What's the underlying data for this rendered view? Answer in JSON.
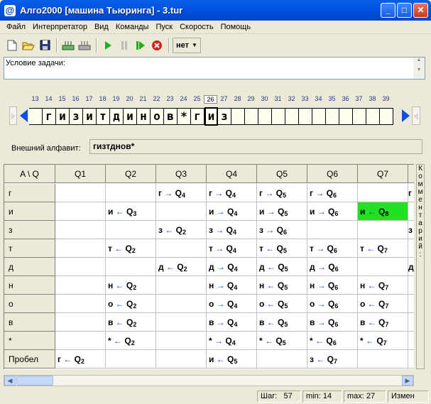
{
  "window": {
    "title": "Алго2000 [машина Тьюринга] - 3.tur",
    "app_icon": "@"
  },
  "menu": [
    "Файл",
    "Интерпретатор",
    "Вид",
    "Команды",
    "Пуск",
    "Скорость",
    "Помощь"
  ],
  "toolbar": {
    "speed_label": "нет"
  },
  "condition": {
    "label": "Условие задачи:"
  },
  "tape": {
    "numbers": [
      "13",
      "14",
      "15",
      "16",
      "17",
      "18",
      "19",
      "20",
      "21",
      "22",
      "23",
      "24",
      "25",
      "26",
      "27",
      "28",
      "29",
      "30",
      "31",
      "32",
      "33",
      "34",
      "35",
      "36",
      "37",
      "38",
      "39"
    ],
    "current_number": "26",
    "cells": [
      "",
      "г",
      "и",
      "з",
      "и",
      "т",
      "д",
      "и",
      "н",
      "о",
      "в",
      "*",
      "г",
      "и",
      "з",
      "",
      "",
      "",
      "",
      "",
      "",
      "",
      "",
      "",
      "",
      "",
      ""
    ],
    "current_index": 13
  },
  "alphabet": {
    "label": "Внешний алфавит:",
    "value": "гизтднов*"
  },
  "grid": {
    "corner": "A \\ Q",
    "columns": [
      "Q1",
      "Q2",
      "Q3",
      "Q4",
      "Q5",
      "Q6",
      "Q7"
    ],
    "partial_col_letters": [
      "г",
      "",
      "з",
      "",
      "д",
      "",
      "",
      "",
      "",
      ""
    ],
    "rows": [
      {
        "symbol": "г",
        "cells": [
          null,
          null,
          {
            "s": "г",
            "a": "→",
            "q": "Q",
            "n": "4"
          },
          {
            "s": "г",
            "a": "→",
            "q": "Q",
            "n": "4"
          },
          {
            "s": "г",
            "a": "→",
            "q": "Q",
            "n": "5"
          },
          {
            "s": "г",
            "a": "→",
            "q": "Q",
            "n": "6"
          },
          null
        ]
      },
      {
        "symbol": "и",
        "cells": [
          null,
          {
            "s": "и",
            "a": "←",
            "q": "Q",
            "n": "3"
          },
          null,
          {
            "s": "и",
            "a": "→",
            "q": "Q",
            "n": "4"
          },
          {
            "s": "и",
            "a": "→",
            "q": "Q",
            "n": "5"
          },
          {
            "s": "и",
            "a": "→",
            "q": "Q",
            "n": "6"
          },
          {
            "s": "и",
            "a": "←",
            "q": "Q",
            "n": "8",
            "hl": true
          }
        ]
      },
      {
        "symbol": "з",
        "cells": [
          null,
          null,
          {
            "s": "з",
            "a": "←",
            "q": "Q",
            "n": "2"
          },
          {
            "s": "з",
            "a": "→",
            "q": "Q",
            "n": "4"
          },
          {
            "s": "з",
            "a": "→",
            "q": "Q",
            "n": "6"
          },
          null,
          null
        ]
      },
      {
        "symbol": "т",
        "cells": [
          null,
          {
            "s": "т",
            "a": "←",
            "q": "Q",
            "n": "2"
          },
          null,
          {
            "s": "т",
            "a": "→",
            "q": "Q",
            "n": "4"
          },
          {
            "s": "т",
            "a": "←",
            "q": "Q",
            "n": "5"
          },
          {
            "s": "т",
            "a": "→",
            "q": "Q",
            "n": "6"
          },
          {
            "s": "т",
            "a": "←",
            "q": "Q",
            "n": "7"
          }
        ]
      },
      {
        "symbol": "д",
        "cells": [
          null,
          null,
          {
            "s": "д",
            "a": "←",
            "q": "Q",
            "n": "2"
          },
          {
            "s": "д",
            "a": "→",
            "q": "Q",
            "n": "4"
          },
          {
            "s": "д",
            "a": "←",
            "q": "Q",
            "n": "5"
          },
          {
            "s": "д",
            "a": "→",
            "q": "Q",
            "n": "6"
          },
          null
        ]
      },
      {
        "symbol": "н",
        "cells": [
          null,
          {
            "s": "н",
            "a": "←",
            "q": "Q",
            "n": "2"
          },
          null,
          {
            "s": "н",
            "a": "→",
            "q": "Q",
            "n": "4"
          },
          {
            "s": "н",
            "a": "←",
            "q": "Q",
            "n": "5"
          },
          {
            "s": "н",
            "a": "→",
            "q": "Q",
            "n": "6"
          },
          {
            "s": "н",
            "a": "←",
            "q": "Q",
            "n": "7"
          }
        ]
      },
      {
        "symbol": "о",
        "cells": [
          null,
          {
            "s": "о",
            "a": "←",
            "q": "Q",
            "n": "2"
          },
          null,
          {
            "s": "о",
            "a": "→",
            "q": "Q",
            "n": "4"
          },
          {
            "s": "о",
            "a": "←",
            "q": "Q",
            "n": "5"
          },
          {
            "s": "о",
            "a": "→",
            "q": "Q",
            "n": "6"
          },
          {
            "s": "о",
            "a": "←",
            "q": "Q",
            "n": "7"
          }
        ]
      },
      {
        "symbol": "в",
        "cells": [
          null,
          {
            "s": "в",
            "a": "←",
            "q": "Q",
            "n": "2"
          },
          null,
          {
            "s": "в",
            "a": "→",
            "q": "Q",
            "n": "4"
          },
          {
            "s": "в",
            "a": "←",
            "q": "Q",
            "n": "5"
          },
          {
            "s": "в",
            "a": "→",
            "q": "Q",
            "n": "6"
          },
          {
            "s": "в",
            "a": "←",
            "q": "Q",
            "n": "7"
          }
        ]
      },
      {
        "symbol": "*",
        "cells": [
          null,
          {
            "s": "*",
            "a": "←",
            "q": "Q",
            "n": "2"
          },
          null,
          {
            "s": "*",
            "a": "→",
            "q": "Q",
            "n": "4"
          },
          {
            "s": "*",
            "a": "←",
            "q": "Q",
            "n": "5"
          },
          {
            "s": "*",
            "a": "←",
            "q": "Q",
            "n": "6"
          },
          {
            "s": "*",
            "a": "←",
            "q": "Q",
            "n": "7"
          }
        ]
      },
      {
        "symbol": "Пробел",
        "cells": [
          {
            "s": "г",
            "a": "←",
            "q": "Q",
            "n": "2"
          },
          null,
          null,
          {
            "s": "и",
            "a": "←",
            "q": "Q",
            "n": "5"
          },
          null,
          {
            "s": "з",
            "a": "←",
            "q": "Q",
            "n": "7"
          },
          null
        ]
      }
    ]
  },
  "side_comment": "Комментарий:",
  "status": {
    "step_label": "Шаг:",
    "step_value": "57",
    "min": "min: 14",
    "max": "max: 27",
    "changed": "Измен"
  }
}
